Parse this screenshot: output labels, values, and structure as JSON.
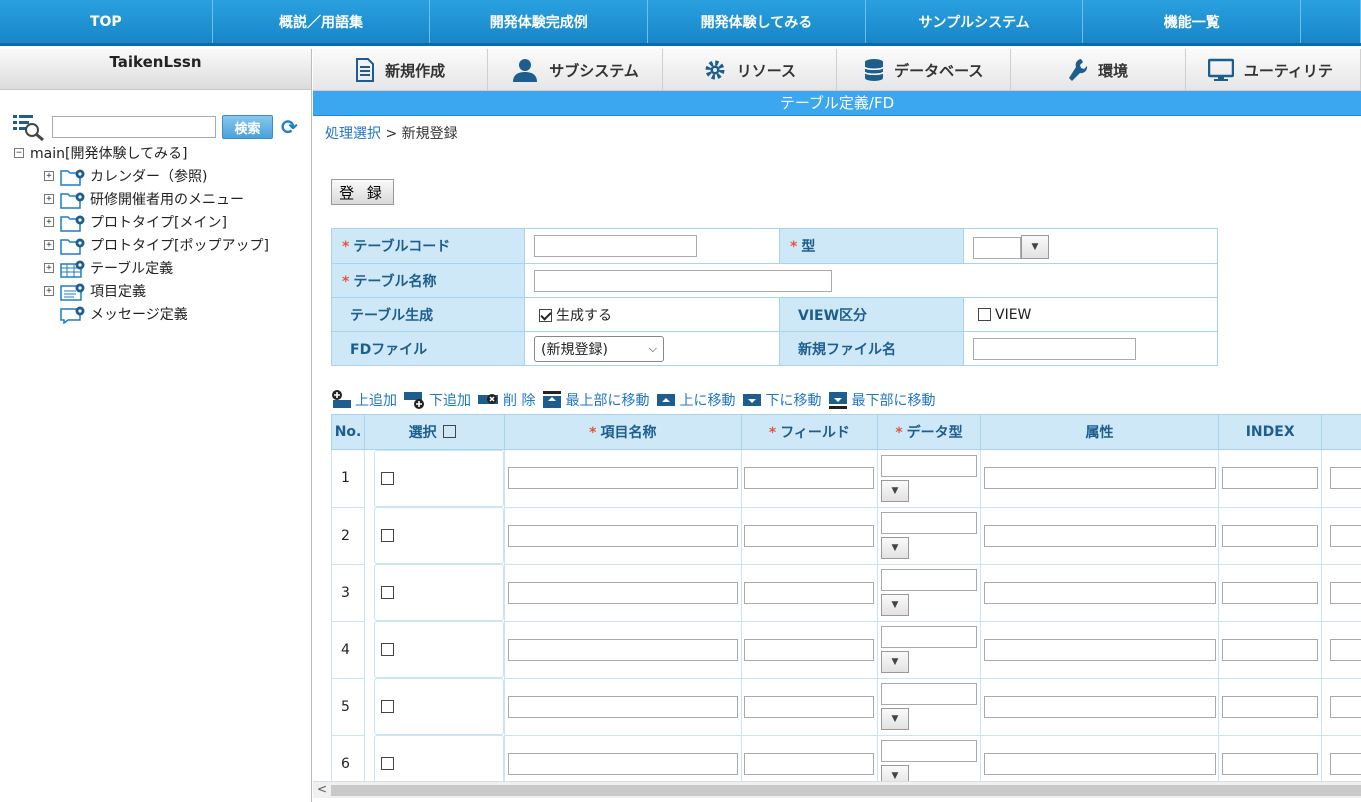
{
  "topnav": [
    "TOP",
    "概説／用語集",
    "開発体験完成例",
    "開発体験してみる",
    "サンプルシステム",
    "機能一覧",
    ""
  ],
  "sidebar": {
    "title": "TaikenLssn",
    "search_button": "検索",
    "root": "main[開発体験してみる]",
    "items": [
      {
        "label": "カレンダー（参照)",
        "expander": "⊞",
        "icon": "folder-gear-icon"
      },
      {
        "label": "研修開催者用のメニュー",
        "expander": "⊞",
        "icon": "folder-gear-icon"
      },
      {
        "label": "プロトタイプ[メイン]",
        "expander": "⊞",
        "icon": "folder-gear-icon"
      },
      {
        "label": "プロトタイプ[ポップアップ]",
        "expander": "⊞",
        "icon": "folder-gear-icon"
      },
      {
        "label": "テーブル定義",
        "expander": "⊞",
        "icon": "table-gear-icon"
      },
      {
        "label": "項目定義",
        "expander": "⊞",
        "icon": "doc-gear-icon"
      },
      {
        "label": "メッセージ定義",
        "expander": "",
        "icon": "message-gear-icon"
      }
    ]
  },
  "toolbar": [
    {
      "label": "新規作成",
      "icon": "document-icon"
    },
    {
      "label": "サブシステム",
      "icon": "user-icon"
    },
    {
      "label": "リソース",
      "icon": "gear-icon"
    },
    {
      "label": "データベース",
      "icon": "database-icon"
    },
    {
      "label": "環境",
      "icon": "wrench-icon"
    },
    {
      "label": "ユーティリテ",
      "icon": "monitor-icon"
    }
  ],
  "bluebar": "テーブル定義/FD",
  "breadcrumb": {
    "link": "処理選択",
    "sep": " > ",
    "current": "新規登録"
  },
  "register_button": "登 録",
  "form": {
    "table_code_label": "テーブルコード",
    "type_label": "型",
    "table_name_label": "テーブル名称",
    "table_gen_label": "テーブル生成",
    "table_gen_check": "生成する",
    "view_kubun_label": "VIEW区分",
    "view_check": "VIEW",
    "fd_file_label": "FDファイル",
    "fd_file_value": "(新規登録)",
    "new_file_label": "新規ファイル名"
  },
  "rowtools": [
    "上追加",
    "下追加",
    "削 除",
    "最上部に移動",
    "上に移動",
    "下に移動",
    "最下部に移動"
  ],
  "grid": {
    "headers": {
      "no": "No.",
      "select": "選択",
      "item_name": "項目名称",
      "field": "フィールド",
      "data_type": "データ型",
      "attr": "属性",
      "index": "INDEX"
    },
    "rows": [
      "1",
      "2",
      "3",
      "4",
      "5",
      "6"
    ]
  },
  "colors": {
    "topnav": "#1786c8",
    "bluebar": "#3aa7f0",
    "label_bg": "#cfe8f8",
    "required": "#e8543b",
    "link": "#2176c8"
  }
}
